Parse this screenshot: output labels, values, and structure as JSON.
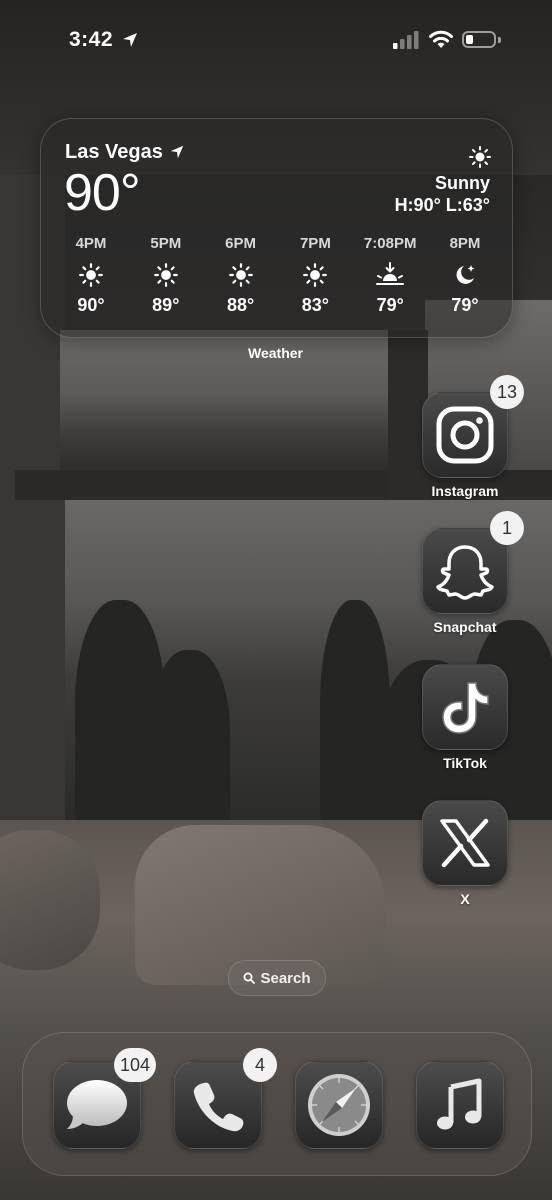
{
  "status_bar": {
    "time": "3:42",
    "signal_bars_active": 1,
    "battery_level": 0.25,
    "icons": [
      "location-arrow-icon",
      "signal-icon",
      "wifi-icon",
      "battery-icon"
    ]
  },
  "weather": {
    "city": "Las Vegas",
    "temperature": "90°",
    "condition": "Sunny",
    "condition_icon": "sun-icon",
    "high_low": "H:90° L:63°",
    "hourly": [
      {
        "time": "4PM",
        "icon": "sun-icon",
        "temp": "90°"
      },
      {
        "time": "5PM",
        "icon": "sun-icon",
        "temp": "89°"
      },
      {
        "time": "6PM",
        "icon": "sun-icon",
        "temp": "88°"
      },
      {
        "time": "7PM",
        "icon": "sun-icon",
        "temp": "83°"
      },
      {
        "time": "7:08PM",
        "icon": "sunset-icon",
        "temp": "79°"
      },
      {
        "time": "8PM",
        "icon": "moon-stars-icon",
        "temp": "79°"
      }
    ],
    "widget_label": "Weather"
  },
  "apps": [
    {
      "name": "Instagram",
      "icon": "instagram-icon",
      "badge": "13"
    },
    {
      "name": "Snapchat",
      "icon": "snapchat-ghost-icon",
      "badge": "1"
    },
    {
      "name": "TikTok",
      "icon": "tiktok-icon",
      "badge": ""
    },
    {
      "name": "X",
      "icon": "x-logo-icon",
      "badge": ""
    }
  ],
  "search": {
    "label": "Search",
    "icon": "search-icon"
  },
  "dock": [
    {
      "app": "Messages",
      "icon": "messages-icon",
      "badge": "104"
    },
    {
      "app": "Phone",
      "icon": "phone-icon",
      "badge": "4"
    },
    {
      "app": "Safari",
      "icon": "safari-compass-icon",
      "badge": ""
    },
    {
      "app": "Music",
      "icon": "music-note-icon",
      "badge": ""
    }
  ]
}
